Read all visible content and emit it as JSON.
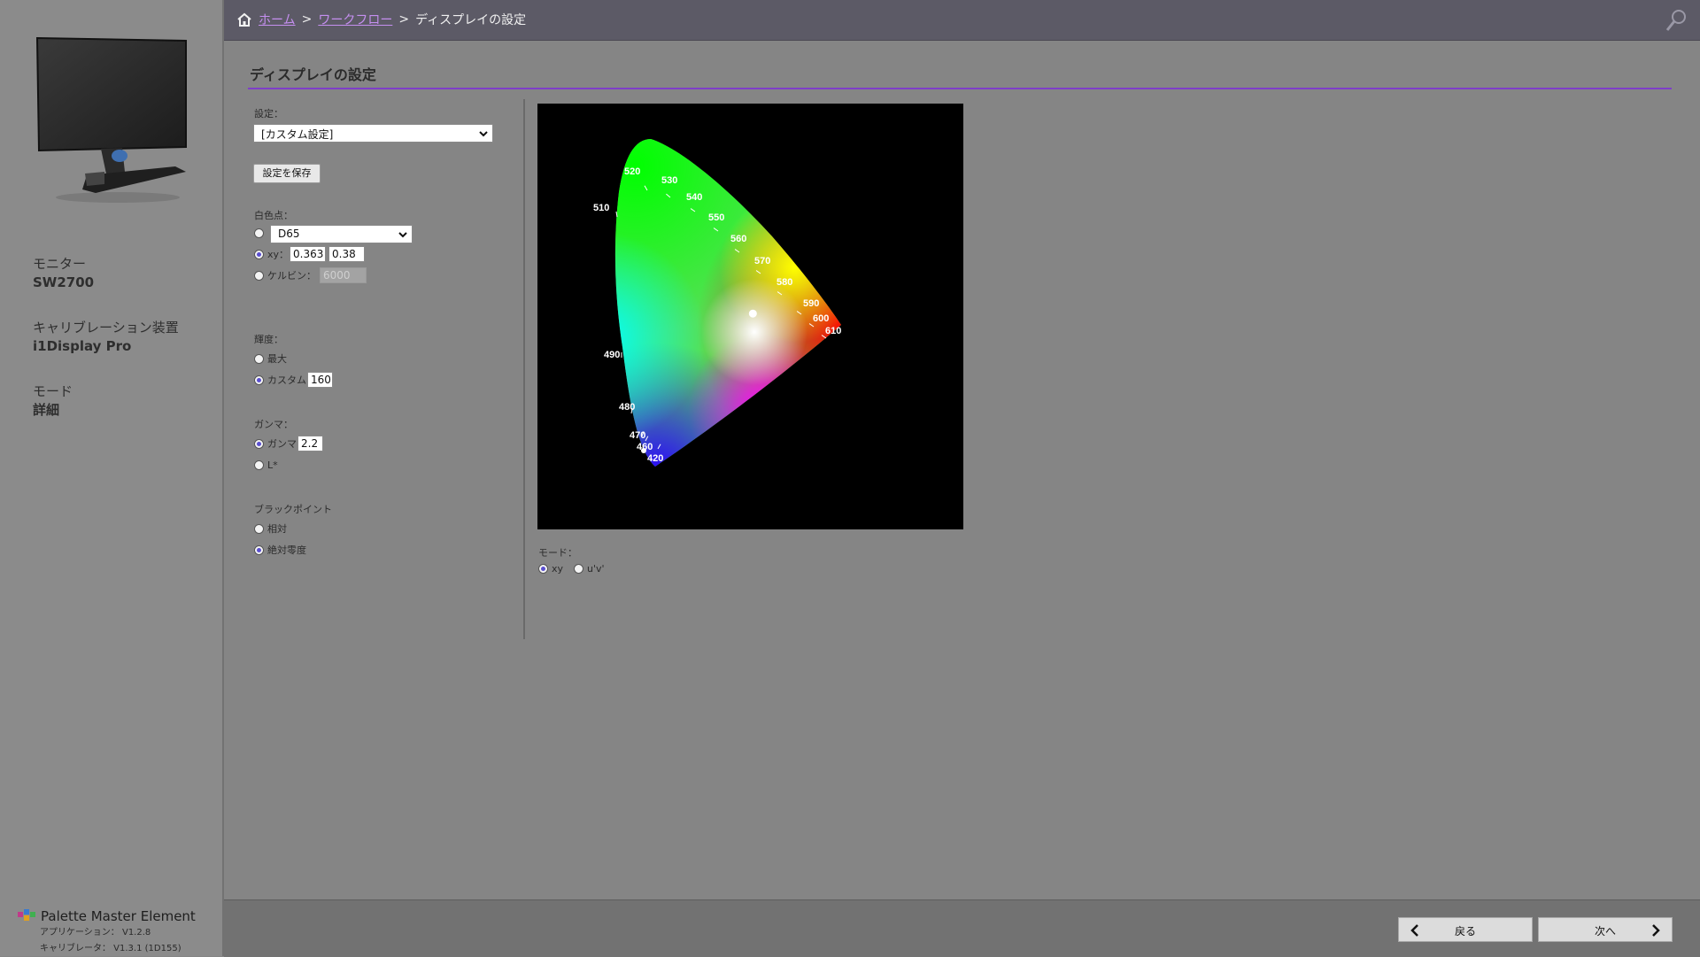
{
  "sidebar": {
    "monitor_label": "モニター",
    "monitor_value": "SW2700",
    "device_label": "キャリブレーション装置",
    "device_value": "i1Display Pro",
    "mode_label": "モード",
    "mode_value": "詳細"
  },
  "app": {
    "name": "Palette Master Element",
    "app_version": "アプリケーション： V1.2.8",
    "calibrator_version": "キャリブレータ： V1.3.1 (1D155)"
  },
  "header": {
    "breadcrumb": [
      "ホーム",
      "ワークフロー",
      "ディスプレイの設定"
    ],
    "separator": ">",
    "home_icon": "home-icon",
    "search_icon": "search-icon"
  },
  "page": {
    "title": "ディスプレイの設定"
  },
  "settings": {
    "preset_label": "設定：",
    "preset_value": "[カスタム設定]",
    "save_label": "設定を保存",
    "whitepoint_label": "白色点：",
    "whitepoint_preset": "D65",
    "xy_label": "xy：",
    "x_value": "0.363",
    "y_value": "0.38",
    "kelvin_label": "ケルビン：",
    "kelvin_value": "6000",
    "luminance_label": "輝度：",
    "lum_max_label": "最大",
    "lum_custom_label": "カスタム",
    "lum_custom_value": "160",
    "gamma_label": "ガンマ：",
    "gamma_option_label": "ガンマ",
    "gamma_value": "2.2",
    "lstar_label": "L*",
    "blackpoint_label": "ブラックポイント",
    "bp_relative_label": "相対",
    "bp_absolute_label": "絶対零度",
    "selected": {
      "whitepoint": "xy",
      "luminance": "custom",
      "gamma": "gamma",
      "blackpoint": "absolute"
    }
  },
  "chart_mode": {
    "label": "モード：",
    "xy_label": "xy",
    "uv_label": "u'v'",
    "selected": "xy"
  },
  "chart_data": {
    "type": "scatter",
    "description_type": "chromaticity",
    "locus_labels": [
      "420",
      "460",
      "470",
      "480",
      "490",
      "510",
      "520",
      "530",
      "540",
      "550",
      "560",
      "570",
      "580",
      "590",
      "600",
      "610"
    ],
    "whitepoint": {
      "x": 0.363,
      "y": 0.38
    },
    "colors": {
      "background": "#000000"
    }
  },
  "footer": {
    "back_label": "戻る",
    "next_label": "次へ"
  },
  "colors": {
    "accent": "#7e3ec8",
    "header_bg": "#5c5a66",
    "link": "#c58ff0"
  }
}
